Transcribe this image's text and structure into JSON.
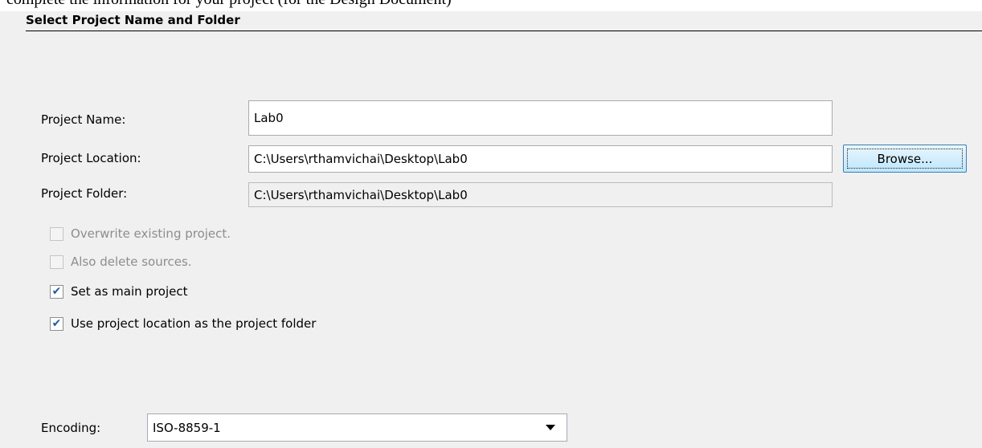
{
  "top_strip": {
    "text": "complete the information for your project (for the Design Document)"
  },
  "section": {
    "title": "Select Project Name and Folder"
  },
  "form": {
    "project_name": {
      "label": "Project Name:",
      "value": "Lab0"
    },
    "project_location": {
      "label": "Project Location:",
      "value": "C:\\Users\\rthamvichai\\Desktop\\Lab0"
    },
    "project_folder": {
      "label": "Project Folder:",
      "value": "C:\\Users\\rthamvichai\\Desktop\\Lab0"
    },
    "browse_label": "Browse..."
  },
  "options": [
    {
      "label": "Overwrite existing project.",
      "checked": false,
      "enabled": false
    },
    {
      "label": "Also delete sources.",
      "checked": false,
      "enabled": false
    },
    {
      "label": "Set as main project",
      "checked": true,
      "enabled": true
    },
    {
      "label": "Use project location as the project folder",
      "checked": true,
      "enabled": true
    }
  ],
  "encoding": {
    "label": "Encoding:",
    "value": "ISO-8859-1"
  },
  "icons": {
    "check": "checkmark-icon",
    "dropdown": "chevron-down-icon"
  }
}
